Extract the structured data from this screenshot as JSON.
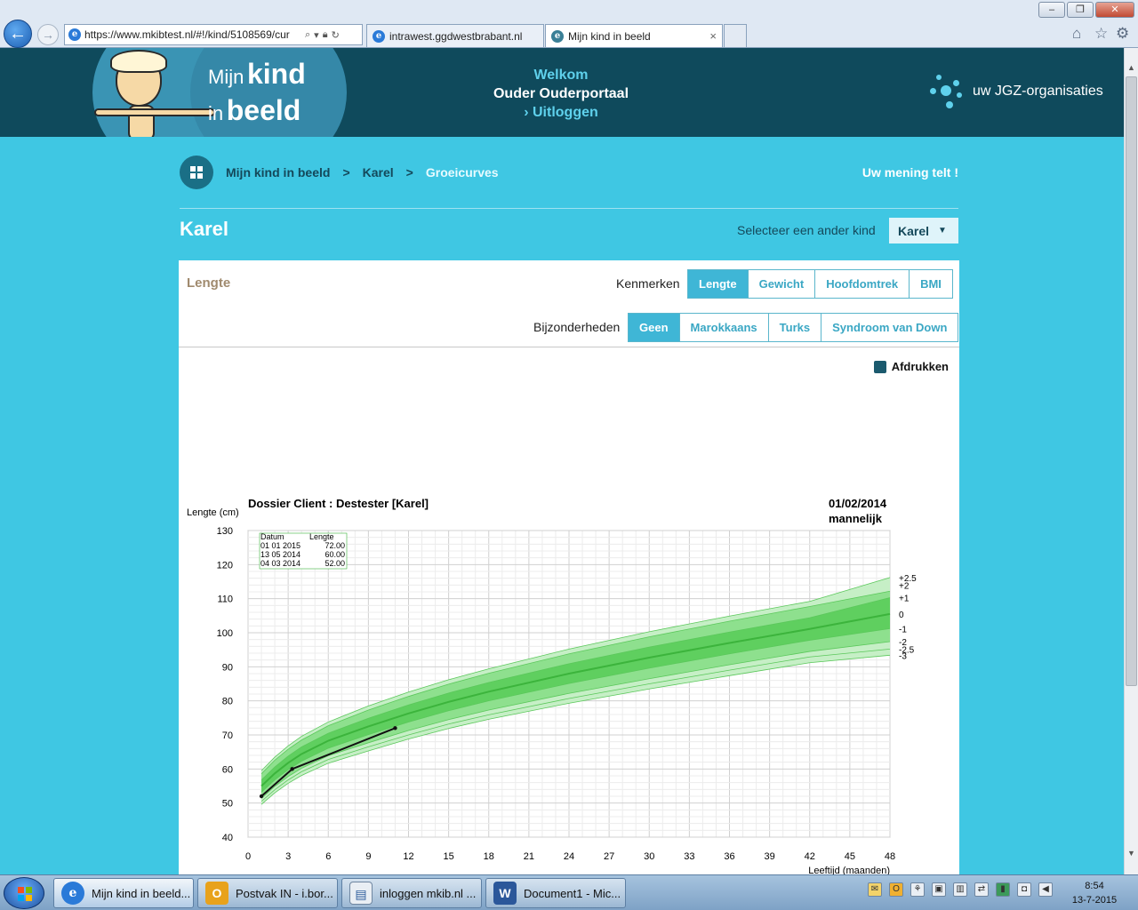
{
  "browser": {
    "url": "https://www.mkibtest.nl/#!/kind/5108569/cur",
    "tabs": [
      {
        "label": "intrawest.ggdwestbrabant.nl",
        "active": false
      },
      {
        "label": "Mijn kind in beeld",
        "active": true
      }
    ],
    "tab_close": "×"
  },
  "header": {
    "logo_line1_small": "Mijn",
    "logo_line1_big": "kind",
    "logo_line2_small": "in",
    "logo_line2_big": "beeld",
    "welcome": "Welkom",
    "portal": "Ouder Ouderportaal",
    "logout": "Uitloggen",
    "org": "uw JGZ-organisaties"
  },
  "breadcrumb": {
    "items": [
      "Mijn kind in beeld",
      "Karel",
      "Groeicurves"
    ],
    "separator": ">",
    "feedback": "Uw mening telt !"
  },
  "child": {
    "name": "Karel",
    "select_label": "Selecteer een ander kind",
    "selected": "Karel"
  },
  "panel": {
    "title": "Lengte",
    "kenmerken_label": "Kenmerken",
    "kenmerken": [
      {
        "label": "Lengte",
        "active": true
      },
      {
        "label": "Gewicht",
        "active": false
      },
      {
        "label": "Hoofdomtrek",
        "active": false
      },
      {
        "label": "BMI",
        "active": false
      }
    ],
    "bijzonderheden_label": "Bijzonderheden",
    "bijzonderheden": [
      {
        "label": "Geen",
        "active": true
      },
      {
        "label": "Marokkaans",
        "active": false
      },
      {
        "label": "Turks",
        "active": false
      },
      {
        "label": "Syndroom van Down",
        "active": false
      }
    ],
    "print_label": "Afdrukken"
  },
  "chart_data": {
    "type": "line",
    "title": "Dossier Client : Destester [Karel]",
    "date": "01/02/2014",
    "sex": "mannelijk",
    "ylabel": "Lengte (cm)",
    "xlabel": "Leeftijd (maanden)",
    "xlim": [
      0,
      48
    ],
    "ylim": [
      40,
      130
    ],
    "xticks": [
      0,
      3,
      6,
      9,
      12,
      15,
      18,
      21,
      24,
      27,
      30,
      33,
      36,
      39,
      42,
      45,
      48
    ],
    "yticks": [
      40,
      50,
      60,
      70,
      80,
      90,
      100,
      110,
      120,
      130
    ],
    "table": {
      "headers": [
        "Datum",
        "Lengte"
      ],
      "rows": [
        [
          "01 01  2015",
          "72.00"
        ],
        [
          "13 05  2014",
          "60.00"
        ],
        [
          "04 03  2014",
          "52.00"
        ]
      ]
    },
    "measurements": {
      "x": [
        1,
        3.3,
        11
      ],
      "y": [
        52,
        60,
        72
      ]
    },
    "reference_ages": [
      1,
      2,
      3,
      4,
      6,
      9,
      12,
      15,
      18,
      24,
      30,
      36,
      42,
      48
    ],
    "sd_lines": [
      {
        "label": "+2.5",
        "values": [
          59.5,
          63.5,
          66.8,
          69.6,
          73.8,
          78.5,
          82.6,
          86.2,
          89.4,
          95.2,
          100.3,
          104.9,
          109.2,
          116.2
        ]
      },
      {
        "label": "+2",
        "values": [
          58.6,
          62.6,
          65.8,
          68.5,
          72.7,
          77.3,
          81.3,
          84.9,
          88.1,
          93.8,
          98.8,
          103.4,
          107.7,
          112.2
        ]
      },
      {
        "label": "+1",
        "values": [
          56.8,
          60.6,
          63.8,
          66.5,
          70.5,
          74.9,
          78.8,
          82.3,
          85.4,
          90.9,
          95.8,
          100.2,
          104.4,
          110.3
        ]
      },
      {
        "label": "0",
        "values": [
          55.0,
          58.7,
          61.8,
          64.4,
          68.3,
          72.5,
          76.3,
          79.7,
          82.7,
          88.0,
          92.7,
          97.0,
          101.1,
          105.5
        ]
      },
      {
        "label": "-1",
        "values": [
          53.2,
          56.8,
          59.8,
          62.3,
          66.1,
          70.1,
          73.8,
          77.1,
          80.0,
          85.1,
          89.6,
          93.8,
          97.8,
          101.2
        ]
      },
      {
        "label": "-2",
        "values": [
          51.4,
          54.9,
          57.8,
          60.2,
          63.9,
          67.7,
          71.3,
          74.5,
          77.3,
          82.2,
          86.5,
          90.6,
          94.5,
          97.4
        ]
      },
      {
        "label": "-2.5",
        "values": [
          50.5,
          53.9,
          56.8,
          59.2,
          62.8,
          66.5,
          70.0,
          73.2,
          75.9,
          80.7,
          85.0,
          89.0,
          92.9,
          95.2
        ]
      },
      {
        "label": "-3",
        "values": [
          49.6,
          53.0,
          55.8,
          58.1,
          61.7,
          65.3,
          68.8,
          71.9,
          74.6,
          79.3,
          83.5,
          87.4,
          91.2,
          93.4
        ]
      }
    ],
    "sd_label_positions": [
      116.2,
      114.0,
      110.3,
      105.5,
      101.2,
      97.4,
      95.2,
      93.4
    ],
    "colors": {
      "line": "#111111",
      "band_outer": "#c6efc6",
      "band_mid": "#8ee08e",
      "band_inner": "#5fcf5f",
      "median": "#3cb43c",
      "grid": "#d8d8d8"
    }
  },
  "taskbar": {
    "items": [
      {
        "label": "Mijn kind in beeld...",
        "icon": "ie-icon",
        "active": true
      },
      {
        "label": "Postvak IN - i.bor...",
        "icon": "outlook-icon",
        "active": false
      },
      {
        "label": "inloggen mkib.nl ...",
        "icon": "document-icon",
        "active": false
      },
      {
        "label": "Document1 - Mic...",
        "icon": "word-icon",
        "active": false
      }
    ],
    "time": "8:54",
    "date": "13-7-2015"
  }
}
